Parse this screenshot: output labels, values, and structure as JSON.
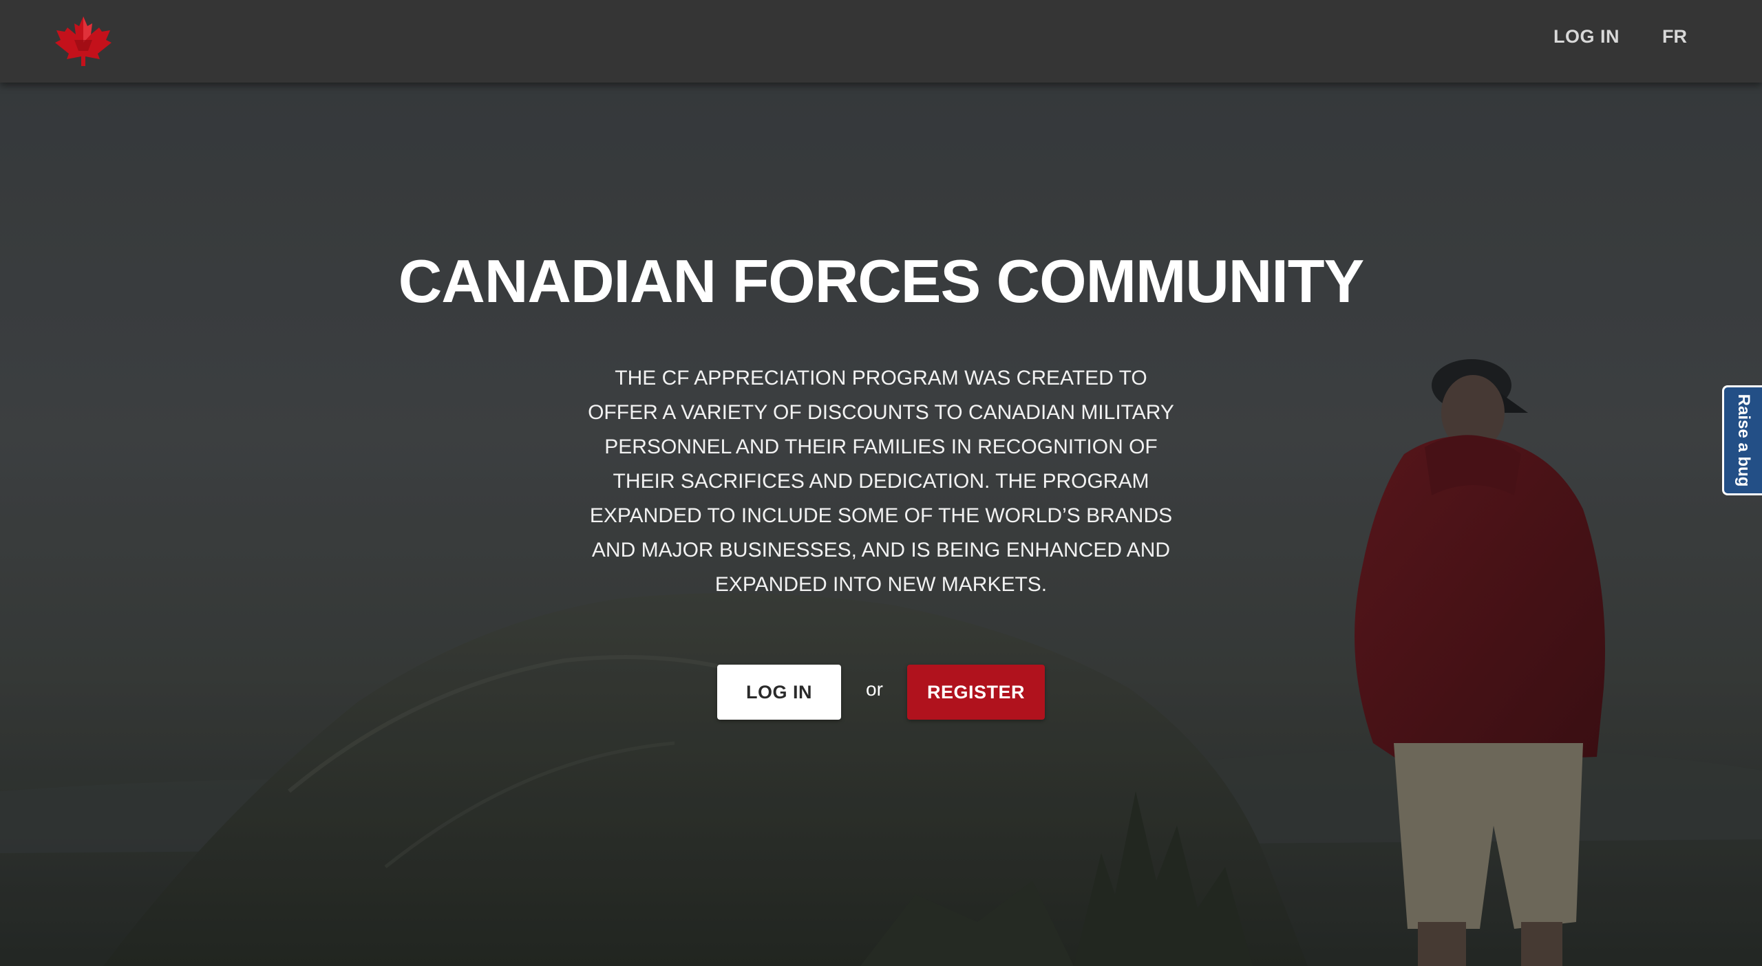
{
  "colors": {
    "navbar_bg": "#353535",
    "brand_red": "#b0121d",
    "bug_tab_bg": "#234f86",
    "text_primary": "#ffffff"
  },
  "navbar": {
    "logo_icon": "maple-leaf-icon",
    "login_label": "LOG IN",
    "language_label": "FR"
  },
  "hero": {
    "title": "CANADIAN FORCES COMMUNITY",
    "description": "THE CF APPRECIATION PROGRAM WAS CREATED TO OFFER A VARIETY OF DISCOUNTS TO CANADIAN MILITARY PERSONNEL AND THEIR FAMILIES IN RECOGNITION OF THEIR SACRIFICES AND DEDICATION. THE PROGRAM EXPANDED TO INCLUDE SOME OF THE WORLD’S BRANDS AND MAJOR BUSINESSES, AND IS BEING ENHANCED AND EXPANDED INTO NEW MARKETS.",
    "login_button": "LOG IN",
    "or_text": "or",
    "register_button": "REGISTER"
  },
  "feedback": {
    "raise_bug_label": "Raise a bug"
  }
}
